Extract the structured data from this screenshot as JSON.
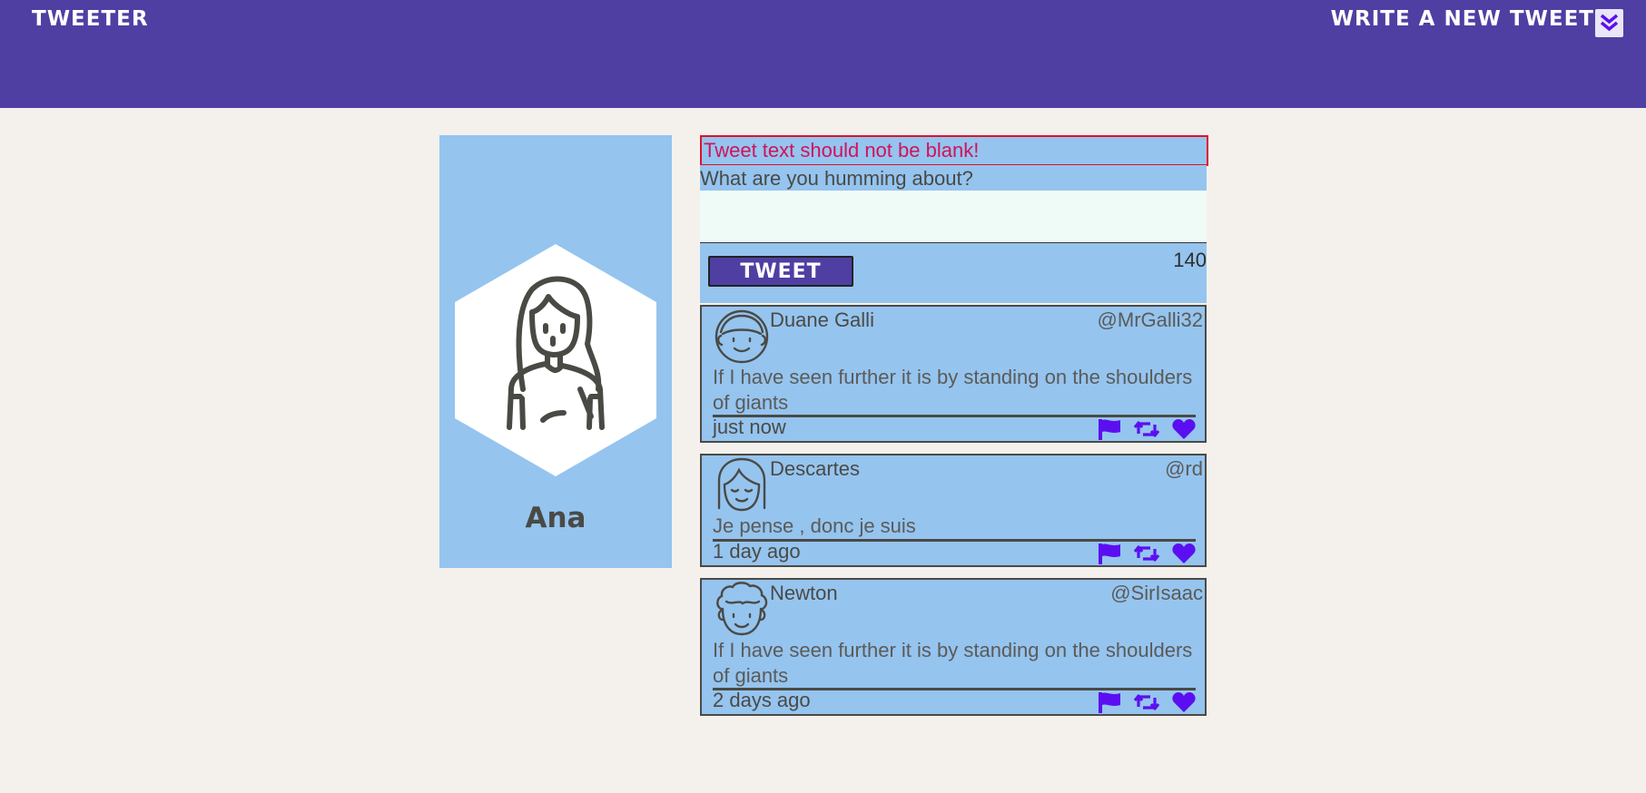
{
  "navbar": {
    "brand": "Tweeter",
    "compose_toggle": "Write a new tweet",
    "toggle_icon": "double-chevron-down-icon",
    "background": "#4f3fa3"
  },
  "profile": {
    "name": "Ana",
    "avatar_icon": "woman-avatar-icon",
    "card_color": "#95c4ef"
  },
  "compose": {
    "error": "Tweet text should not be blank!",
    "label": "What are you humming about?",
    "textarea_value": "",
    "button_label": "Tweet",
    "char_counter": "140"
  },
  "tweets": [
    {
      "author": "Duane Galli",
      "handle": "@MrGalli32",
      "text": "If I have seen further it is by standing on the shoulders of giants",
      "time": "just now",
      "avatar_icon": "man-avatar-icon"
    },
    {
      "author": "Descartes",
      "handle": "@rd",
      "text": "Je pense , donc je suis",
      "time": "1 day ago",
      "avatar_icon": "bob-hair-avatar-icon"
    },
    {
      "author": "Newton",
      "handle": "@SirIsaac",
      "text": "If I have seen further it is by standing on the shoulders of giants",
      "time": "2 days ago",
      "avatar_icon": "curly-hair-avatar-icon"
    }
  ],
  "action_icons": [
    "flag-icon",
    "retweet-icon",
    "heart-icon"
  ],
  "colors": {
    "accent": "#4f3fa3",
    "action": "#5b0ff0",
    "error_border": "#e0112b",
    "page_bg": "#f4f1ed"
  }
}
